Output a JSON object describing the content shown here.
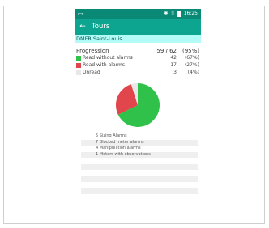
{
  "statusbar": {
    "notification_icon": "message-icon",
    "bluetooth_icon": "bluetooth-icon",
    "signal_icon": "signal-icon",
    "battery_icon": "battery-icon",
    "time": "16:25"
  },
  "appbar": {
    "back_icon": "arrow-left-icon",
    "title": "Tours"
  },
  "subtitle": "DMFR Saint-Louis",
  "progression": {
    "label": "Progression",
    "value": "59 / 62",
    "percent": "(95%)",
    "items": [
      {
        "label": "Read without alarms",
        "value": "42",
        "percent": "(67%)",
        "color": "#2fc14a"
      },
      {
        "label": "Read with alarms",
        "value": "17",
        "percent": "(27%)",
        "color": "#e0464b"
      },
      {
        "label": "Unread",
        "value": "3",
        "percent": "(4%)",
        "color": "#e8e8e8"
      }
    ]
  },
  "chart_data": {
    "type": "pie",
    "slices": [
      {
        "label": "Read without alarms",
        "value": 42,
        "color": "#2fc14a"
      },
      {
        "label": "Read with alarms",
        "value": 17,
        "color": "#e0464b"
      },
      {
        "label": "Unread",
        "value": 3,
        "color": "#e8e8e8"
      }
    ]
  },
  "alarms": [
    "5 Sizing Alarms",
    "7 Blocked meter alarms",
    "4 Manipulation alarms",
    "1 Meters with observations",
    "",
    "",
    "",
    "",
    "",
    ""
  ]
}
